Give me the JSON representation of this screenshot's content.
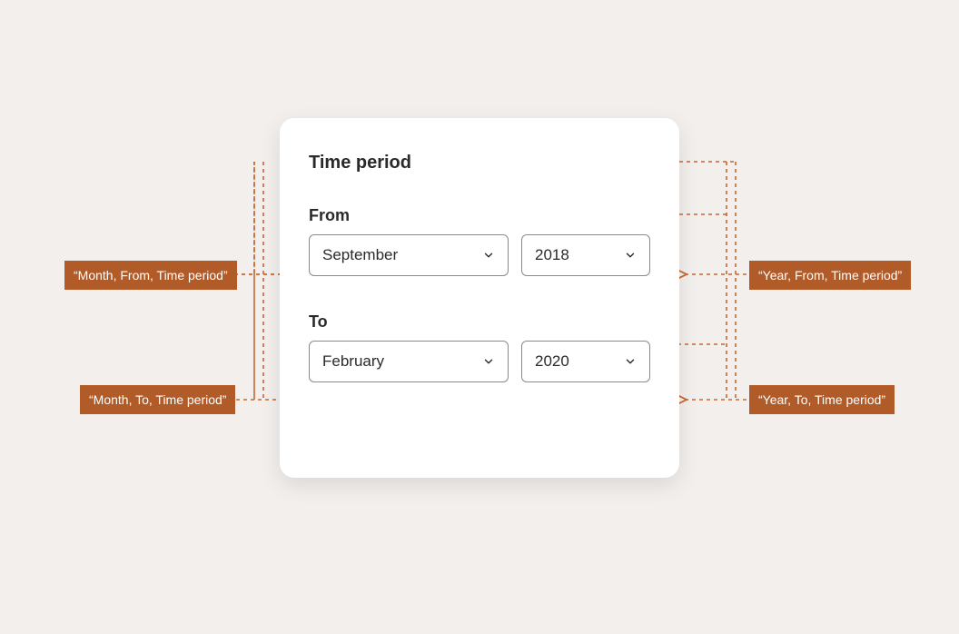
{
  "card": {
    "title": "Time period",
    "from": {
      "label": "From",
      "month": "September",
      "year": "2018"
    },
    "to": {
      "label": "To",
      "month": "February",
      "year": "2020"
    }
  },
  "annotations": {
    "from_month": "“Month, From, Time period”",
    "from_year": "“Year, From, Time period”",
    "to_month": "“Month, To, Time period”",
    "to_year": "“Year, To, Time period”"
  },
  "colors": {
    "accent": "#b15b29"
  }
}
